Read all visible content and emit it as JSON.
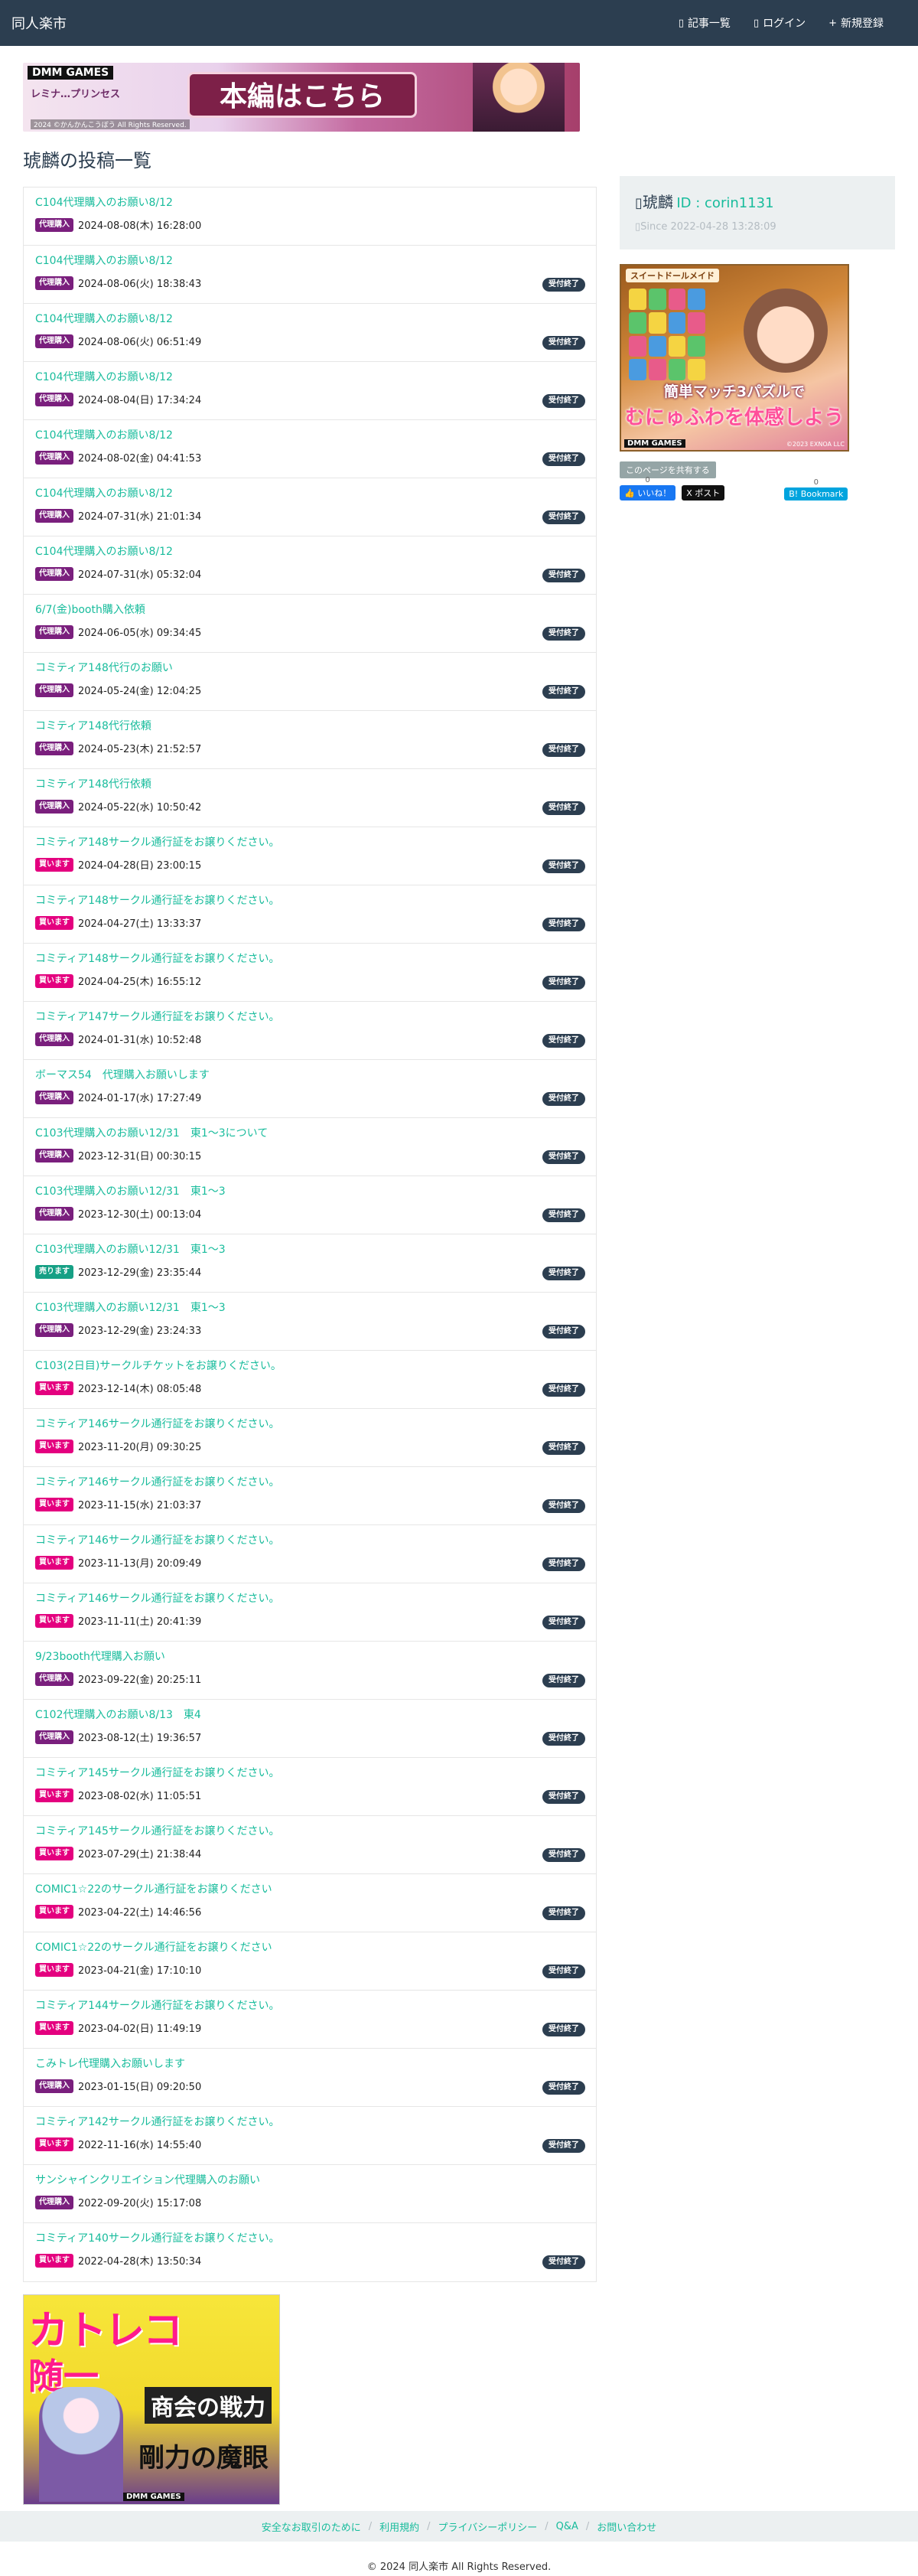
{
  "nav": {
    "brand": "同人楽市",
    "links": [
      {
        "icon": "list-icon",
        "glyph": "▯",
        "label": "記事一覧"
      },
      {
        "icon": "login-icon",
        "glyph": "▯",
        "label": "ログイン"
      },
      {
        "icon": "plus-icon",
        "glyph": "+",
        "label": "新規登録"
      }
    ]
  },
  "banner_top": {
    "brand": "DMM GAMES",
    "game": "レミナ…プリンセス",
    "cta": "本編はこちら",
    "copyright": "2024 ©かんかんこうぼう All Rights Reserved."
  },
  "page": {
    "title": "琥麟の投稿一覧"
  },
  "badge_colors": {
    "代理購入": "#7a1f7d",
    "買います": "#e4007f",
    "売ります": "#16a085"
  },
  "posts": [
    {
      "title": "C104代理購入のお願い8/12",
      "badge": "代理購入",
      "date": "2024-08-08(木) 16:28:00",
      "status": ""
    },
    {
      "title": "C104代理購入のお願い8/12",
      "badge": "代理購入",
      "date": "2024-08-06(火) 18:38:43",
      "status": "受付終了"
    },
    {
      "title": "C104代理購入のお願い8/12",
      "badge": "代理購入",
      "date": "2024-08-06(火) 06:51:49",
      "status": "受付終了"
    },
    {
      "title": "C104代理購入のお願い8/12",
      "badge": "代理購入",
      "date": "2024-08-04(日) 17:34:24",
      "status": "受付終了"
    },
    {
      "title": "C104代理購入のお願い8/12",
      "badge": "代理購入",
      "date": "2024-08-02(金) 04:41:53",
      "status": "受付終了"
    },
    {
      "title": "C104代理購入のお願い8/12",
      "badge": "代理購入",
      "date": "2024-07-31(水) 21:01:34",
      "status": "受付終了"
    },
    {
      "title": "C104代理購入のお願い8/12",
      "badge": "代理購入",
      "date": "2024-07-31(水) 05:32:04",
      "status": "受付終了"
    },
    {
      "title": "6/7(金)booth購入依頼",
      "badge": "代理購入",
      "date": "2024-06-05(水) 09:34:45",
      "status": "受付終了"
    },
    {
      "title": "コミティア148代行のお願い",
      "badge": "代理購入",
      "date": "2024-05-24(金) 12:04:25",
      "status": "受付終了"
    },
    {
      "title": "コミティア148代行依頼",
      "badge": "代理購入",
      "date": "2024-05-23(木) 21:52:57",
      "status": "受付終了"
    },
    {
      "title": "コミティア148代行依頼",
      "badge": "代理購入",
      "date": "2024-05-22(水) 10:50:42",
      "status": "受付終了"
    },
    {
      "title": "コミティア148サークル通行証をお譲りください。",
      "badge": "買います",
      "date": "2024-04-28(日) 23:00:15",
      "status": "受付終了"
    },
    {
      "title": "コミティア148サークル通行証をお譲りください。",
      "badge": "買います",
      "date": "2024-04-27(土) 13:33:37",
      "status": "受付終了"
    },
    {
      "title": "コミティア148サークル通行証をお譲りください。",
      "badge": "買います",
      "date": "2024-04-25(木) 16:55:12",
      "status": "受付終了"
    },
    {
      "title": "コミティア147サークル通行証をお譲りください。",
      "badge": "代理購入",
      "date": "2024-01-31(水) 10:52:48",
      "status": "受付終了"
    },
    {
      "title": "ボーマス54　代理購入お願いします",
      "badge": "代理購入",
      "date": "2024-01-17(水) 17:27:49",
      "status": "受付終了"
    },
    {
      "title": "C103代理購入のお願い12/31　東1〜3について",
      "badge": "代理購入",
      "date": "2023-12-31(日) 00:30:15",
      "status": "受付終了"
    },
    {
      "title": "C103代理購入のお願い12/31　東1〜3",
      "badge": "代理購入",
      "date": "2023-12-30(土) 00:13:04",
      "status": "受付終了"
    },
    {
      "title": "C103代理購入のお願い12/31　東1〜3",
      "badge": "売ります",
      "date": "2023-12-29(金) 23:35:44",
      "status": "受付終了"
    },
    {
      "title": "C103代理購入のお願い12/31　東1〜3",
      "badge": "代理購入",
      "date": "2023-12-29(金) 23:24:33",
      "status": "受付終了"
    },
    {
      "title": "C103(2日目)サークルチケットをお譲りください。",
      "badge": "買います",
      "date": "2023-12-14(木) 08:05:48",
      "status": "受付終了"
    },
    {
      "title": "コミティア146サークル通行証をお譲りください。",
      "badge": "買います",
      "date": "2023-11-20(月) 09:30:25",
      "status": "受付終了"
    },
    {
      "title": "コミティア146サークル通行証をお譲りください。",
      "badge": "買います",
      "date": "2023-11-15(水) 21:03:37",
      "status": "受付終了"
    },
    {
      "title": "コミティア146サークル通行証をお譲りください。",
      "badge": "買います",
      "date": "2023-11-13(月) 20:09:49",
      "status": "受付終了"
    },
    {
      "title": "コミティア146サークル通行証をお譲りください。",
      "badge": "買います",
      "date": "2023-11-11(土) 20:41:39",
      "status": "受付終了"
    },
    {
      "title": "9/23booth代理購入お願い",
      "badge": "代理購入",
      "date": "2023-09-22(金) 20:25:11",
      "status": "受付終了"
    },
    {
      "title": "C102代理購入のお願い8/13　東4",
      "badge": "代理購入",
      "date": "2023-08-12(土) 19:36:57",
      "status": "受付終了"
    },
    {
      "title": "コミティア145サークル通行証をお譲りください。",
      "badge": "買います",
      "date": "2023-08-02(水) 11:05:51",
      "status": "受付終了"
    },
    {
      "title": "コミティア145サークル通行証をお譲りください。",
      "badge": "買います",
      "date": "2023-07-29(土) 21:38:44",
      "status": "受付終了"
    },
    {
      "title": "COMIC1☆22のサークル通行証をお譲りください",
      "badge": "買います",
      "date": "2023-04-22(土) 14:46:56",
      "status": "受付終了"
    },
    {
      "title": "COMIC1☆22のサークル通行証をお譲りください",
      "badge": "買います",
      "date": "2023-04-21(金) 17:10:10",
      "status": "受付終了"
    },
    {
      "title": "コミティア144サークル通行証をお譲りください。",
      "badge": "買います",
      "date": "2023-04-02(日) 11:49:19",
      "status": "受付終了"
    },
    {
      "title": "こみトレ代理購入お願いします",
      "badge": "代理購入",
      "date": "2023-01-15(日) 09:20:50",
      "status": "受付終了"
    },
    {
      "title": "コミティア142サークル通行証をお譲りください。",
      "badge": "買います",
      "date": "2022-11-16(水) 14:55:40",
      "status": "受付終了"
    },
    {
      "title": "サンシャインクリエイション代理購入のお願い",
      "badge": "代理購入",
      "date": "2022-09-20(火) 15:17:08",
      "status": ""
    },
    {
      "title": "コミティア140サークル通行証をお譲りください。",
      "badge": "買います",
      "date": "2022-04-28(木) 13:50:34",
      "status": "受付終了"
    }
  ],
  "profile": {
    "name": "琥麟",
    "id_label": "ID : corin1131",
    "since": "Since 2022-04-28 13:28:09"
  },
  "ad_side": {
    "tag": "スイートドールメイド",
    "line1": "簡単マッチ3パズルで",
    "line2": "むにゅふわを体感しよう",
    "brand": "DMM GAMES",
    "copyright": "©2023 EXNOA LLC"
  },
  "share": {
    "label": "このページを共有する",
    "buttons": [
      {
        "name": "facebook-like-button",
        "count": "0",
        "label": "👍 いいね！"
      },
      {
        "name": "x-post-button",
        "count": "",
        "label": "X ポスト"
      },
      {
        "name": "hatena-bookmark-button",
        "count": "0",
        "label": "B! Bookmark"
      }
    ]
  },
  "ad_bottom": {
    "line1": "カトレコ",
    "line2": "随一",
    "line3": "商会の戦力",
    "line4": "剛力の魔眼",
    "brand": "DMM GAMES"
  },
  "footer": {
    "links": [
      "安全なお取引のために",
      "利用規約",
      "プライバシーポリシー",
      "Q&A",
      "お問い合わせ"
    ],
    "copyright": "© 2024 同人楽市 All Rights Reserved."
  }
}
